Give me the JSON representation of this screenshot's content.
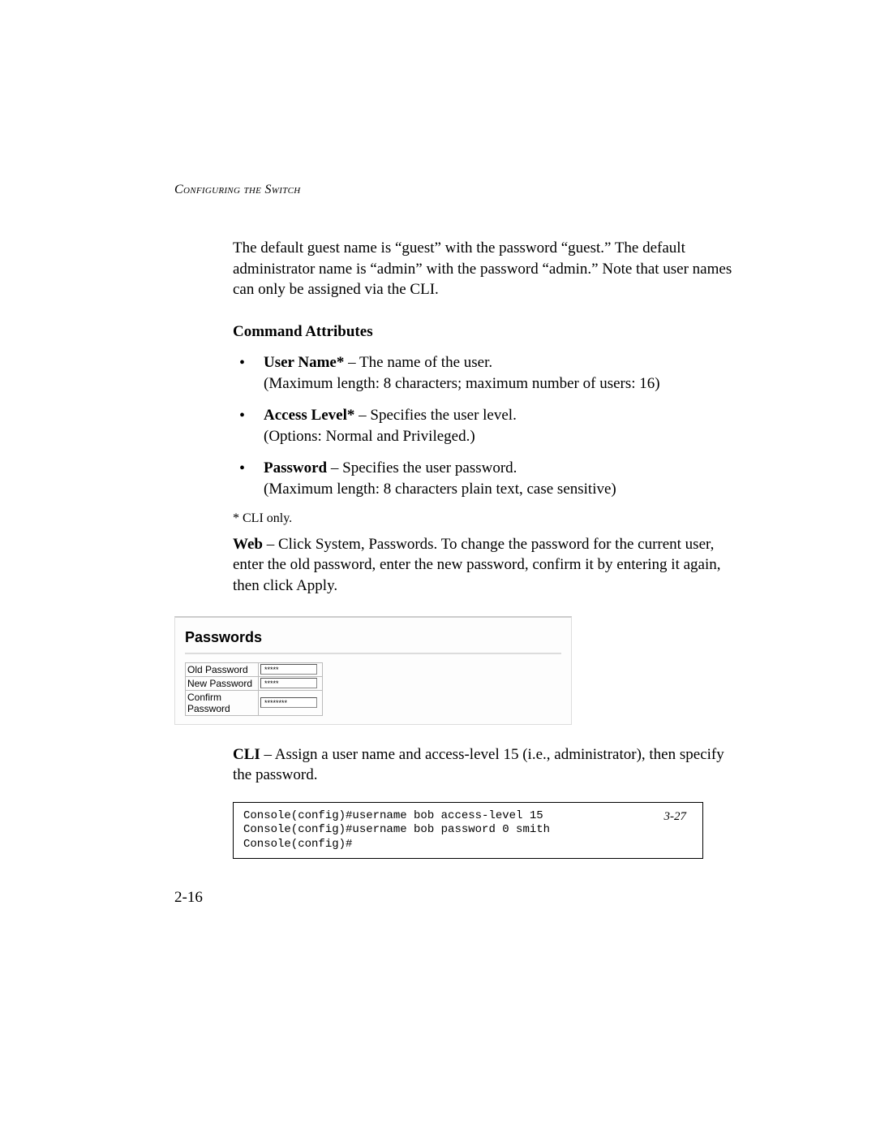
{
  "header": "Configuring the Switch",
  "intro": "The default guest name is “guest” with the password “guest.” The default administrator name is “admin” with the password “admin.” Note that user names can only be assigned via the CLI.",
  "section_heading": "Command Attributes",
  "attributes": [
    {
      "term": "User Name*",
      "desc": " – The name of the user.",
      "note": "(Maximum length: 8 characters; maximum number of users: 16)"
    },
    {
      "term": "Access Level*",
      "desc": " – Specifies the user level.",
      "note": "(Options: Normal and Privileged.)"
    },
    {
      "term": "Password",
      "desc": " – Specifies the user password.",
      "note": "(Maximum length: 8 characters plain text, case sensitive)"
    }
  ],
  "footnote": "* CLI only.",
  "web_label": "Web",
  "web_text": " – Click System, Passwords. To change the password for the current user, enter the old password, enter the new password, confirm it by entering it again, then click Apply.",
  "screenshot": {
    "title": "Passwords",
    "rows": [
      {
        "label": "Old Password",
        "value": "*****"
      },
      {
        "label": "New Password",
        "value": "*****"
      },
      {
        "label": "Confirm Password",
        "value": "********"
      }
    ]
  },
  "cli_label": "CLI",
  "cli_text": " – Assign a user name and access-level 15 (i.e., administrator), then specify the password.",
  "cli_lines": [
    "Console(config)#username bob access-level 15",
    "Console(config)#username bob password 0 smith",
    "Console(config)#"
  ],
  "cli_ref": "3-27",
  "page_number": "2-16"
}
